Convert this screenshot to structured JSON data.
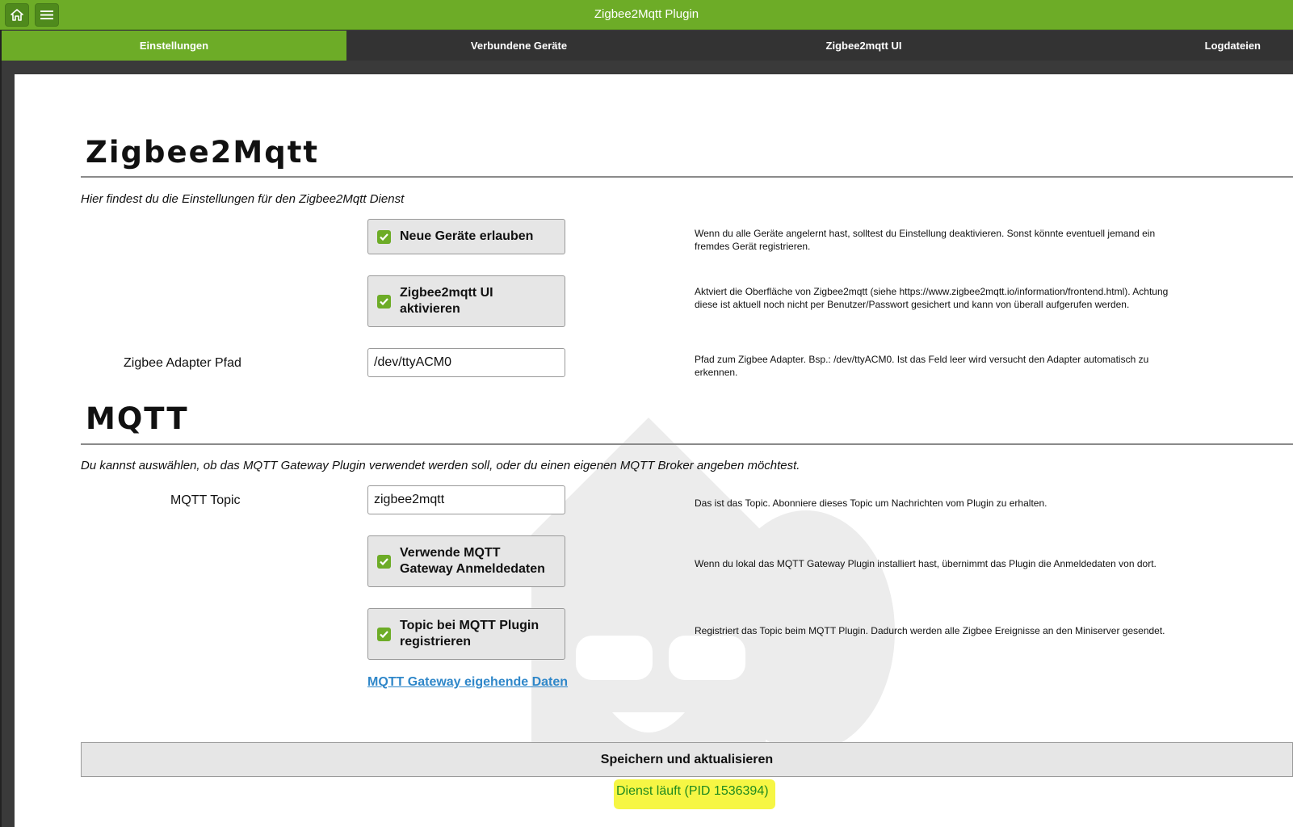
{
  "header": {
    "title": "Zigbee2Mqtt Plugin",
    "home_icon": "home-icon",
    "menu_icon": "hamburger-menu-icon",
    "color": "#6dac27"
  },
  "tabs": [
    {
      "label": "Einstellungen",
      "active": true
    },
    {
      "label": "Verbundene Geräte",
      "active": false
    },
    {
      "label": "Zigbee2mqtt UI",
      "active": false
    },
    {
      "label": "Logdateien",
      "active": false
    }
  ],
  "zigbee": {
    "heading": "Zigbee2Mqtt",
    "description": "Hier findest du die Einstellungen für den Zigbee2Mqtt Dienst",
    "allow_new_devices": {
      "label": "Neue Geräte erlauben",
      "checked": true,
      "help": "Wenn du alle Geräte angelernt hast, solltest du Einstellung deaktivieren. Sonst könnte eventuell jemand ein fremdes Gerät registrieren."
    },
    "enable_ui": {
      "label": "Zigbee2mqtt UI aktivieren",
      "checked": true,
      "help": "Aktviert die Oberfläche von Zigbee2mqtt (siehe https://www.zigbee2mqtt.io/information/frontend.html). Achtung diese ist aktuell noch nicht per Benutzer/Passwort gesichert und kann von überall aufgerufen werden."
    },
    "adapter_path": {
      "label": "Zigbee Adapter Pfad",
      "value": "/dev/ttyACM0",
      "help": "Pfad zum Zigbee Adapter. Bsp.: /dev/ttyACM0. Ist das Feld leer wird versucht den Adapter automatisch zu erkennen."
    }
  },
  "mqtt": {
    "heading": "MQTT",
    "description": "Du kannst auswählen, ob das MQTT Gateway Plugin verwendet werden soll, oder du einen eigenen MQTT Broker angeben möchtest.",
    "topic": {
      "label": "MQTT Topic",
      "value": "zigbee2mqtt",
      "help": "Das ist das Topic. Abonniere dieses Topic um Nachrichten vom Plugin zu erhalten."
    },
    "use_gateway_credentials": {
      "label": "Verwende MQTT Gateway Anmeldedaten",
      "checked": true,
      "help": "Wenn du lokal das MQTT Gateway Plugin installiert hast, übernimmt das Plugin die Anmeldedaten von dort."
    },
    "register_topic": {
      "label": "Topic bei MQTT Plugin registrieren",
      "checked": true,
      "help": "Registriert das Topic beim MQTT Plugin. Dadurch werden alle Zigbee Ereignisse an den Miniserver gesendet."
    },
    "incoming_link": "MQTT Gateway eigehende Daten"
  },
  "save_label": "Speichern und aktualisieren",
  "status": "Dienst läuft (PID 1536394)"
}
